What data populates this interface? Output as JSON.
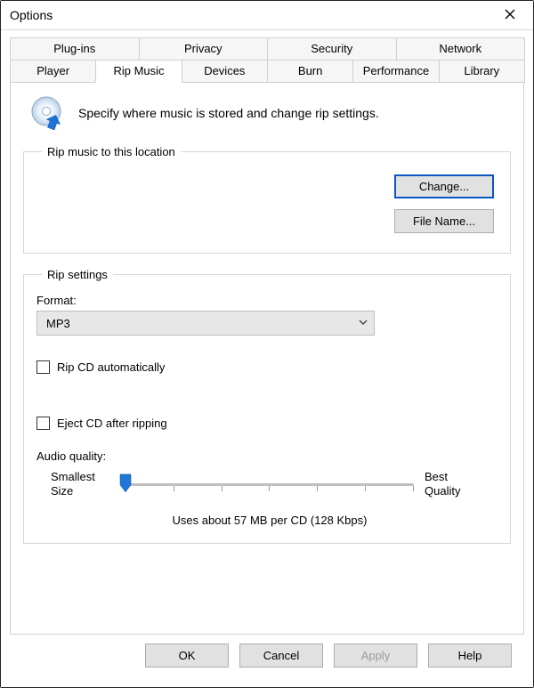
{
  "window": {
    "title": "Options"
  },
  "tabs_row1": [
    {
      "label": "Plug-ins"
    },
    {
      "label": "Privacy"
    },
    {
      "label": "Security"
    },
    {
      "label": "Network"
    }
  ],
  "tabs_row2": [
    {
      "label": "Player"
    },
    {
      "label": "Rip Music",
      "active": true
    },
    {
      "label": "Devices"
    },
    {
      "label": "Burn"
    },
    {
      "label": "Performance"
    },
    {
      "label": "Library"
    }
  ],
  "intro": {
    "text": "Specify where music is stored and change rip settings."
  },
  "location_group": {
    "legend": "Rip music to this location",
    "change_label": "Change...",
    "filename_label": "File Name..."
  },
  "settings_group": {
    "legend": "Rip settings",
    "format_label": "Format:",
    "format_value": "MP3",
    "rip_auto_label": "Rip CD automatically",
    "eject_label": "Eject CD after ripping",
    "audio_quality_label": "Audio quality:",
    "slider_left_line1": "Smallest",
    "slider_left_line2": "Size",
    "slider_right_line1": "Best",
    "slider_right_line2": "Quality",
    "slider_note": "Uses about 57 MB per CD (128 Kbps)"
  },
  "buttons": {
    "ok": "OK",
    "cancel": "Cancel",
    "apply": "Apply",
    "help": "Help"
  }
}
